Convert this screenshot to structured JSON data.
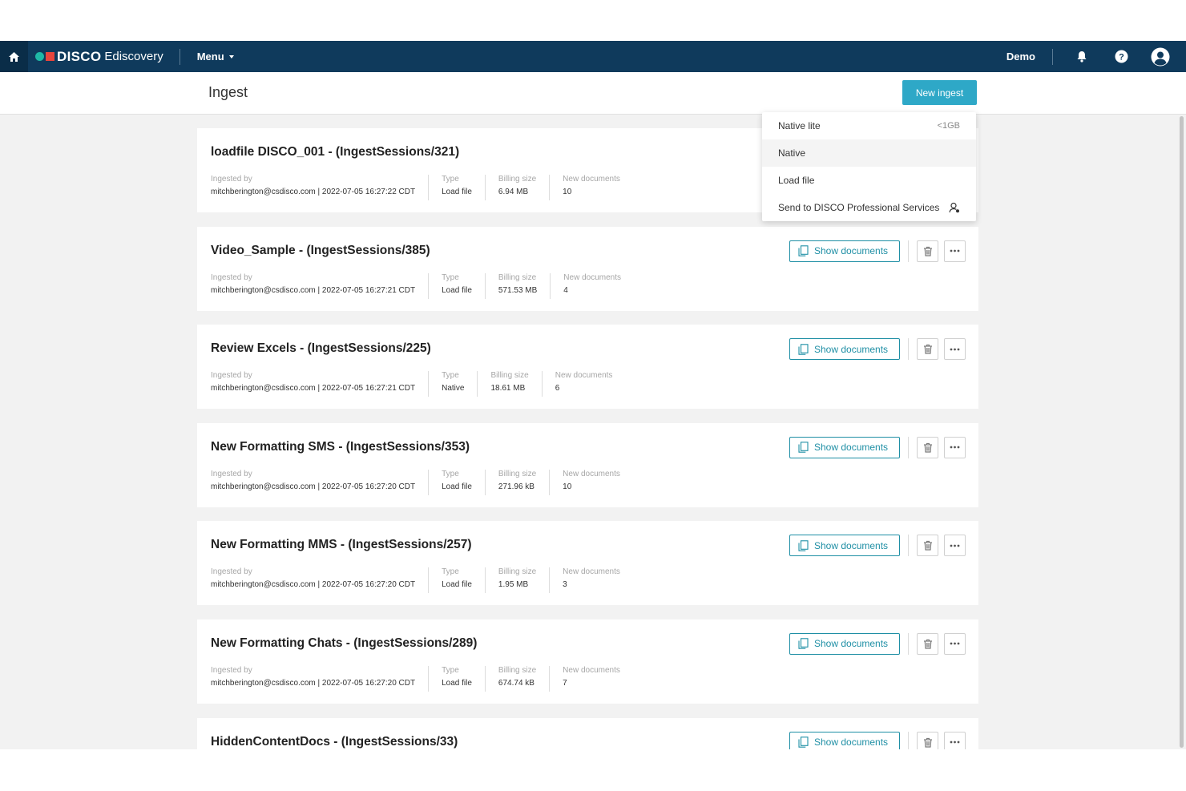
{
  "nav": {
    "brand": "DISCO",
    "product": "Ediscovery",
    "menu_label": "Menu",
    "workspace": "Demo"
  },
  "header": {
    "title": "Ingest",
    "new_ingest_label": "New ingest"
  },
  "dropdown": {
    "items": [
      {
        "label": "Native lite",
        "hint": "<1GB"
      },
      {
        "label": "Native",
        "hint": ""
      },
      {
        "label": "Load file",
        "hint": ""
      },
      {
        "label": "Send to DISCO Professional Services",
        "icon": "person-icon"
      }
    ]
  },
  "labels": {
    "ingested_by": "Ingested by",
    "type": "Type",
    "billing_size": "Billing size",
    "new_documents": "New documents",
    "show_documents": "Show documents"
  },
  "cards": [
    {
      "title": "loadfile DISCO_001 - (IngestSessions/321)",
      "ingested_by": "mitchberington@csdisco.com | 2022-07-05 16:27:22 CDT",
      "type": "Load file",
      "billing_size": "6.94 MB",
      "new_documents": "10"
    },
    {
      "title": "Video_Sample - (IngestSessions/385)",
      "ingested_by": "mitchberington@csdisco.com | 2022-07-05 16:27:21 CDT",
      "type": "Load file",
      "billing_size": "571.53 MB",
      "new_documents": "4"
    },
    {
      "title": "Review Excels - (IngestSessions/225)",
      "ingested_by": "mitchberington@csdisco.com | 2022-07-05 16:27:21 CDT",
      "type": "Native",
      "billing_size": "18.61 MB",
      "new_documents": "6"
    },
    {
      "title": "New Formatting SMS - (IngestSessions/353)",
      "ingested_by": "mitchberington@csdisco.com | 2022-07-05 16:27:20 CDT",
      "type": "Load file",
      "billing_size": "271.96 kB",
      "new_documents": "10"
    },
    {
      "title": "New Formatting MMS - (IngestSessions/257)",
      "ingested_by": "mitchberington@csdisco.com | 2022-07-05 16:27:20 CDT",
      "type": "Load file",
      "billing_size": "1.95 MB",
      "new_documents": "3"
    },
    {
      "title": "New Formatting Chats - (IngestSessions/289)",
      "ingested_by": "mitchberington@csdisco.com | 2022-07-05 16:27:20 CDT",
      "type": "Load file",
      "billing_size": "674.74 kB",
      "new_documents": "7"
    },
    {
      "title": "HiddenContentDocs - (IngestSessions/33)",
      "ingested_by": "",
      "type": "",
      "billing_size": "",
      "new_documents": ""
    }
  ],
  "colors": {
    "nav_bg": "#0f3a5c",
    "accent": "#2ea8c7",
    "outline_accent": "#1f8fa5",
    "logo_teal": "#1fb8a6",
    "logo_red": "#e8453c"
  },
  "icons": [
    "home-icon",
    "bell-icon",
    "help-icon",
    "user-avatar-icon",
    "document-icon",
    "trash-icon",
    "more-icon",
    "person-icon"
  ]
}
